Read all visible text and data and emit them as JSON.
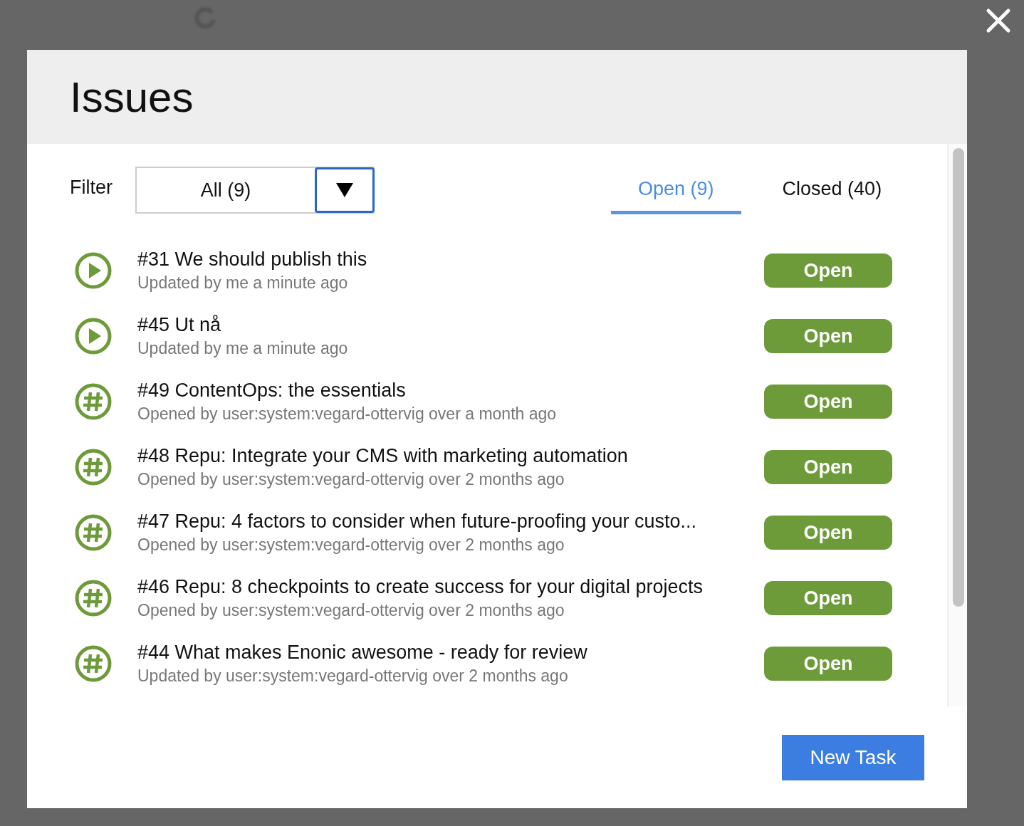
{
  "dialog": {
    "title": "Issues"
  },
  "filter": {
    "label": "Filter",
    "value": "All (9)"
  },
  "tabs": [
    {
      "label": "Open (9)",
      "selected": true
    },
    {
      "label": "Closed (40)",
      "selected": false
    }
  ],
  "issues": [
    {
      "kind": "play",
      "title": "#31 We should publish this",
      "subtitle": "Updated by me a minute ago",
      "status": "Open"
    },
    {
      "kind": "play",
      "title": "#45 Ut nå",
      "subtitle": "Updated by me a minute ago",
      "status": "Open"
    },
    {
      "kind": "hash",
      "title": "#49 ContentOps: the essentials",
      "subtitle": "Opened by user:system:vegard-ottervig over a month ago",
      "status": "Open"
    },
    {
      "kind": "hash",
      "title": "#48 Repu: Integrate your CMS with marketing automation",
      "subtitle": "Opened by user:system:vegard-ottervig over 2 months ago",
      "status": "Open"
    },
    {
      "kind": "hash",
      "title": "#47 Repu: 4 factors to consider when future-proofing your custo...",
      "subtitle": "Opened by user:system:vegard-ottervig over 2 months ago",
      "status": "Open"
    },
    {
      "kind": "hash",
      "title": "#46 Repu: 8 checkpoints to create success for your digital projects",
      "subtitle": "Opened by user:system:vegard-ottervig over 2 months ago",
      "status": "Open"
    },
    {
      "kind": "hash",
      "title": "#44 What makes Enonic awesome - ready for review",
      "subtitle": "Updated by user:system:vegard-ottervig over 2 months ago",
      "status": "Open"
    }
  ],
  "footer": {
    "button": "New Task"
  }
}
